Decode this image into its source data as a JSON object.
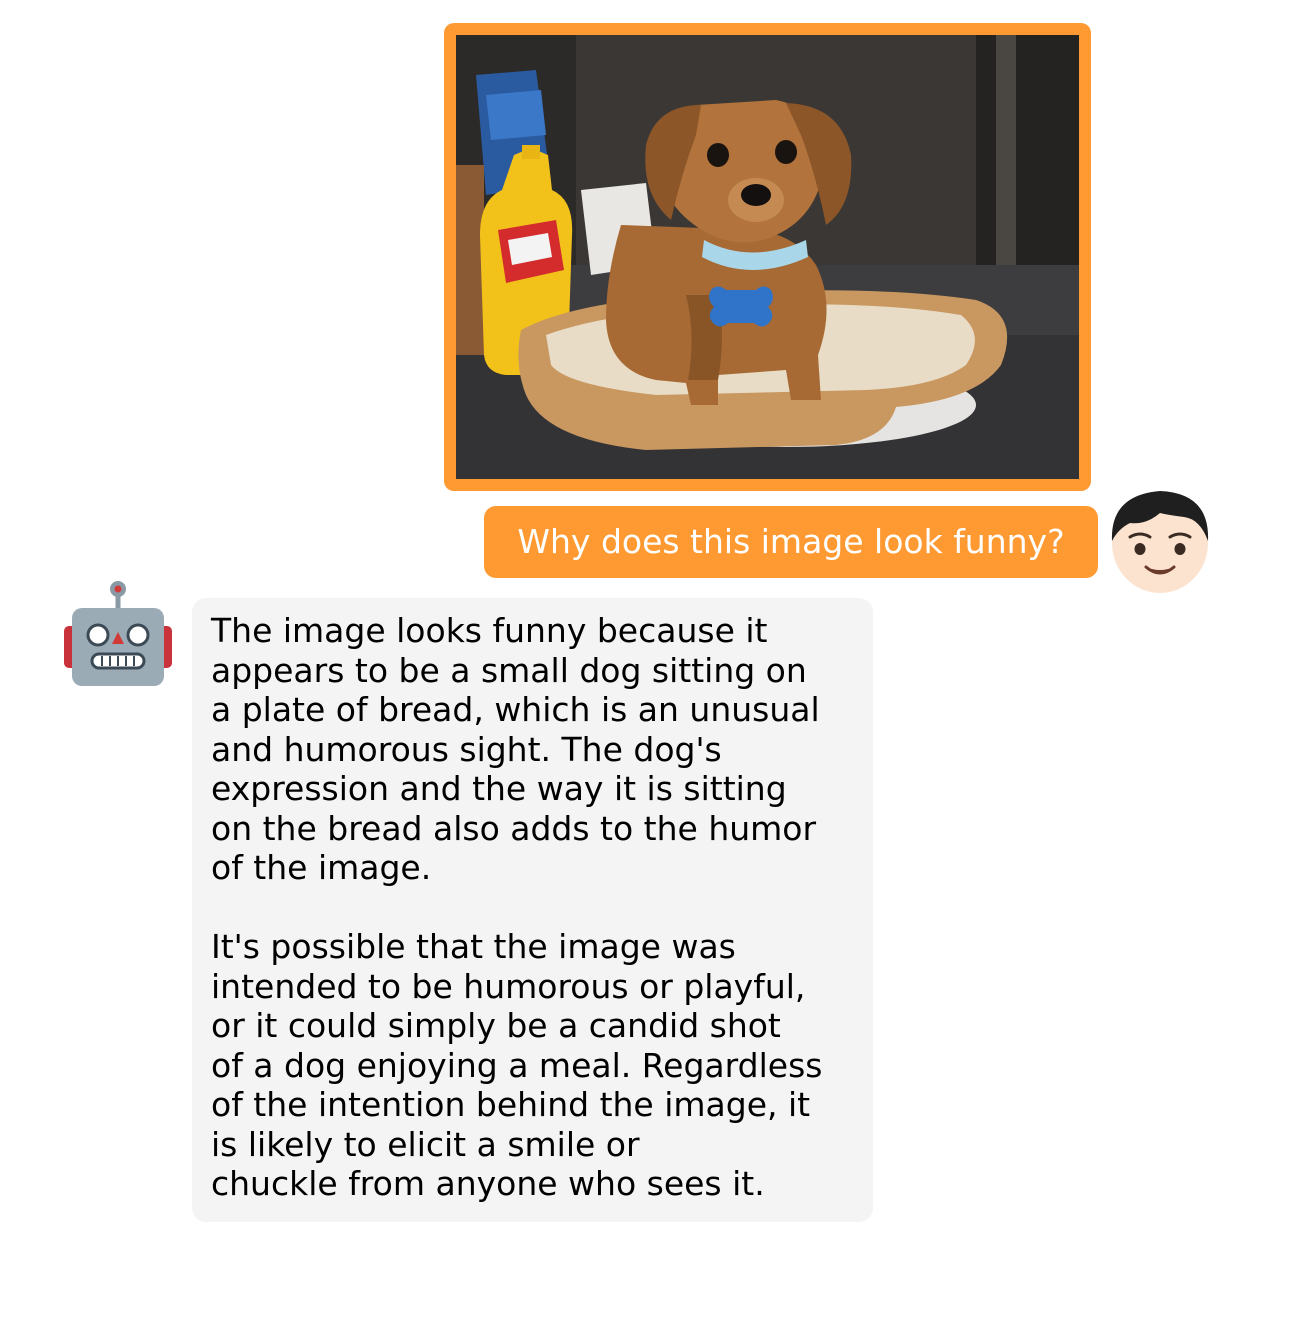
{
  "conversation": {
    "user": {
      "avatar_icon": "boy-face-emoji",
      "image_icon": "dog-on-bread-photo",
      "question": "Why does this image look funny?"
    },
    "assistant": {
      "avatar_icon": "robot-face-emoji",
      "paragraph_1": "The image looks funny because it\nappears to be a small dog sitting on\na plate of bread, which is an unusual\nand humorous sight. The dog's\nexpression and the way it is sitting\non the bread also adds to the humor\nof the image.",
      "paragraph_2": "It's possible that the image was\nintended to be humorous or playful,\nor it could simply be a candid shot\nof a dog enjoying a meal. Regardless\nof the intention behind the image, it\nis likely to elicit a smile or\nchuckle from anyone who sees it."
    }
  },
  "colors": {
    "user_accent": "#ff9a33",
    "assistant_bubble": "#f4f4f4",
    "user_text": "#ffffff",
    "assistant_text": "#000000"
  }
}
